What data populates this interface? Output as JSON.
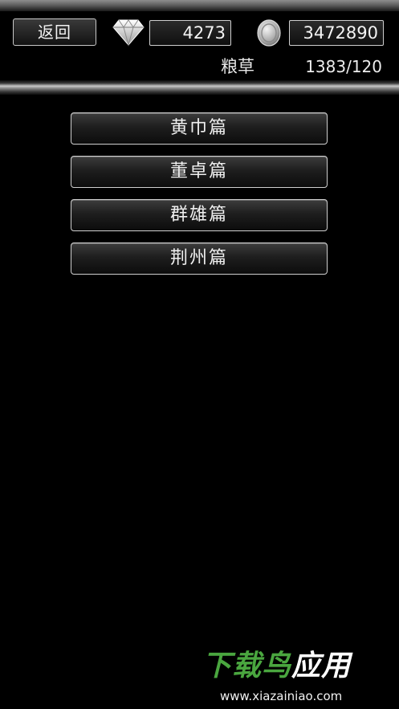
{
  "header": {
    "back_label": "返回",
    "gems": "4273",
    "coins": "3472890",
    "grain_label": "粮草",
    "grain_value": "1383/120"
  },
  "icons": {
    "gem": "diamond-icon",
    "coin": "coin-icon"
  },
  "chapters": [
    {
      "label": "黄巾篇"
    },
    {
      "label": "董卓篇"
    },
    {
      "label": "群雄篇"
    },
    {
      "label": "荆州篇"
    }
  ],
  "watermark": {
    "title_part1": "下载鸟",
    "title_part2": "应用",
    "url": "www.xiazainiao.com"
  },
  "colors": {
    "background": "#000000",
    "border": "#cfcfcf",
    "watermark_green": "#4aa63f"
  }
}
